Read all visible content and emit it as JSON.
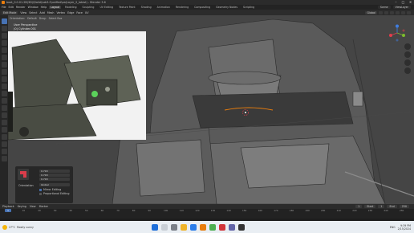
{
  "titlebar": {
    "title": "boot_0.0.01.2B(3D)\\Dalid\\Lab3.0\\unified\\aa(Layer_2_latest) - Blender 3.6",
    "controls": [
      "–",
      "□",
      "✕"
    ]
  },
  "menubar": {
    "menus": [
      "File",
      "Edit",
      "Render",
      "Window",
      "Help"
    ],
    "workspaces": [
      "Layout",
      "Modeling",
      "Sculpting",
      "UV Editing",
      "Texture Paint",
      "Shading",
      "Animation",
      "Rendering",
      "Compositing",
      "Geometry Nodes",
      "Scripting"
    ],
    "active_workspace": "Layout",
    "scene": "Scene",
    "view_layer": "ViewLayer"
  },
  "header": {
    "mode": "Edit Mode",
    "menus": [
      "View",
      "Select",
      "Add",
      "Mesh",
      "Vertex",
      "Edge",
      "Face",
      "UV"
    ],
    "orientation": "Global"
  },
  "subheader": {
    "items": [
      "Orientation:",
      "Default",
      "Drag:",
      "Select Box"
    ]
  },
  "viewport": {
    "view_name": "User Perspective",
    "object_name": "(0) Cylinder.001"
  },
  "redo_panel": {
    "values": [
      "0.718",
      "0.718",
      "0.718"
    ],
    "orientation_label": "Orientation",
    "orientation_value": "Global",
    "mirror_editing": "Mirror Editing",
    "proportional_editing": "Proportional Editing"
  },
  "timeline": {
    "menus": [
      "Playback",
      "Keying",
      "View",
      "Marker"
    ],
    "current_frame": "1",
    "start_label": "Start",
    "start": "1",
    "end_label": "End",
    "end": "250",
    "ticks": [
      "0",
      "10",
      "20",
      "30",
      "40",
      "50",
      "60",
      "70",
      "80",
      "90",
      "100",
      "110",
      "120",
      "130",
      "140",
      "150",
      "160",
      "170",
      "180",
      "190",
      "200",
      "210",
      "220",
      "230",
      "240",
      "250"
    ]
  },
  "taskbar": {
    "weather_temp": "27°C",
    "weather_desc": "Mostly sunny",
    "lang": "ENG",
    "time": "9:39 PM",
    "date": "2/15/2024"
  },
  "colors": {
    "accent": "#4772b3",
    "blender_orange": "#e87d0d",
    "axis_x": "#e23d4c",
    "axis_y": "#7cbb2c",
    "axis_z": "#3f7ee2"
  }
}
